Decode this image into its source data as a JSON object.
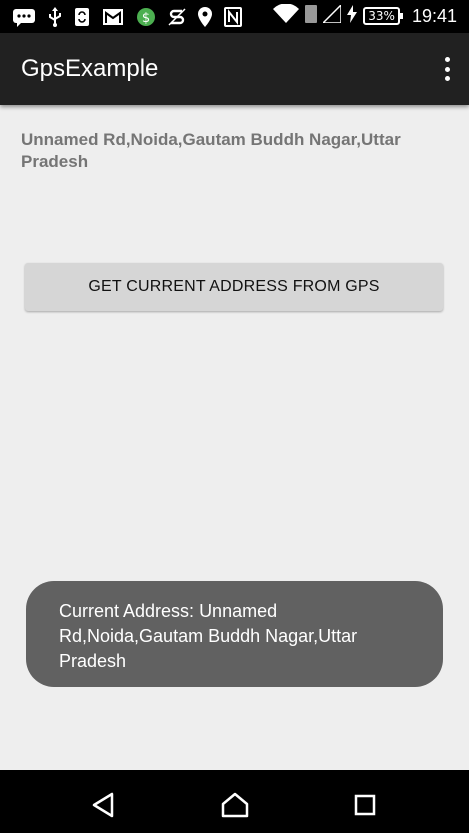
{
  "status_bar": {
    "battery": "33%",
    "time": "19:41",
    "icons": [
      "message-icon",
      "usb-icon",
      "sync-icon",
      "gmail-icon",
      "dollar-icon",
      "s-app-icon",
      "location-icon",
      "nfc-icon",
      "wifi-icon",
      "sim-icon",
      "signal-icon",
      "charging-icon"
    ]
  },
  "app_bar": {
    "title": "GpsExample",
    "menu_icon": "more-vert-icon"
  },
  "main": {
    "address_text": "Unnamed Rd,Noida,Gautam Buddh Nagar,Uttar Pradesh",
    "button_label": "GET CURRENT ADDRESS FROM GPS"
  },
  "toast": {
    "message": "Current Address: Unnamed Rd,Noida,Gautam Buddh Nagar,Uttar Pradesh"
  },
  "nav_bar": {
    "icons": [
      "back-icon",
      "home-icon",
      "recents-icon"
    ]
  },
  "colors": {
    "app_bar": "#212121",
    "background": "#eeeeee",
    "button": "#d6d6d6",
    "toast": "#616161",
    "address_text": "#757575"
  }
}
